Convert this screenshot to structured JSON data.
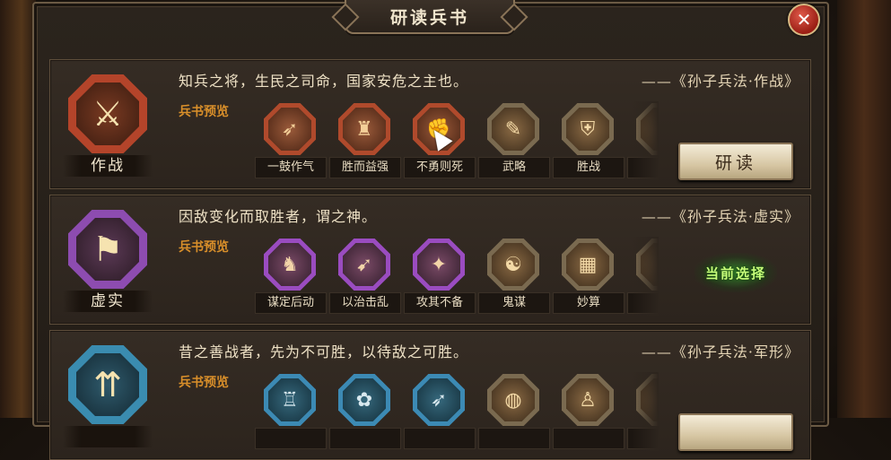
{
  "window": {
    "title": "研读兵书",
    "close_icon": "close-icon",
    "close_glyph": "✕"
  },
  "cards": [
    {
      "emblem_icon": "crossed-swords-icon",
      "emblem_glyph": "⚔",
      "name": "作战",
      "quote": "知兵之将，生民之司命，国家安危之主也。",
      "source": "——《孙子兵法·作战》",
      "preview_label": "兵书预览",
      "skills": [
        {
          "label": "一鼓作气",
          "icon": "spear-rush-icon",
          "glyph": "➶",
          "tone": "red"
        },
        {
          "label": "胜而益强",
          "icon": "warrior-icon",
          "glyph": "♜",
          "tone": "red"
        },
        {
          "label": "不勇则死",
          "icon": "fist-icon",
          "glyph": "✊",
          "tone": "red"
        },
        {
          "label": "武略",
          "icon": "scroll-icon",
          "glyph": "✎",
          "tone": "gold"
        },
        {
          "label": "胜战",
          "icon": "shield-icon",
          "glyph": "⛨",
          "tone": "gold"
        },
        {
          "label": "",
          "icon": "hidden-skill-icon",
          "glyph": "",
          "tone": "gold"
        }
      ],
      "action": "研读",
      "selected": false
    },
    {
      "emblem_icon": "banner-icon",
      "emblem_glyph": "⚑",
      "name": "虚实",
      "quote": "因敌变化而取胜者，谓之神。",
      "source": "——《孙子兵法·虚实》",
      "preview_label": "兵书预览",
      "skills": [
        {
          "label": "谋定后动",
          "icon": "strategist-icon",
          "glyph": "♞",
          "tone": "purple"
        },
        {
          "label": "以治击乱",
          "icon": "archer-icon",
          "glyph": "➹",
          "tone": "purple"
        },
        {
          "label": "攻其不备",
          "icon": "assassin-icon",
          "glyph": "✦",
          "tone": "purple"
        },
        {
          "label": "鬼谋",
          "icon": "advisor-icon",
          "glyph": "☯",
          "tone": "gold"
        },
        {
          "label": "妙算",
          "icon": "abacus-icon",
          "glyph": "▦",
          "tone": "gold"
        },
        {
          "label": "",
          "icon": "hidden-skill-icon",
          "glyph": "",
          "tone": "gold"
        }
      ],
      "current_label": "当前选择",
      "selected": true
    },
    {
      "emblem_icon": "formation-icon",
      "emblem_glyph": "⇈",
      "name": "",
      "quote": "昔之善战者，先为不可胜，以待敌之可胜。",
      "source": "——《孙子兵法·军形》",
      "preview_label": "兵书预览",
      "skills": [
        {
          "label": "",
          "icon": "fortress-icon",
          "glyph": "♖",
          "tone": "blue"
        },
        {
          "label": "",
          "icon": "palm-tree-icon",
          "glyph": "✿",
          "tone": "blue"
        },
        {
          "label": "",
          "icon": "lancer-icon",
          "glyph": "➶",
          "tone": "blue"
        },
        {
          "label": "",
          "icon": "drum-icon",
          "glyph": "◍",
          "tone": "gold"
        },
        {
          "label": "",
          "icon": "monk-icon",
          "glyph": "♙",
          "tone": "gold"
        },
        {
          "label": "",
          "icon": "hidden-skill-icon",
          "glyph": "",
          "tone": "gold"
        }
      ],
      "action": "",
      "selected": false
    }
  ]
}
